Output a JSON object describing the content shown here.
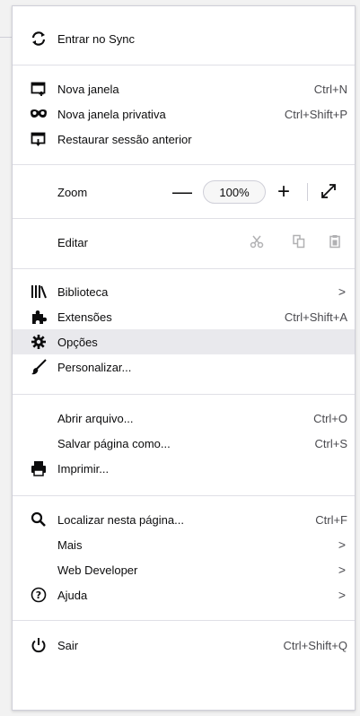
{
  "menu": {
    "sync": {
      "label": "Entrar no Sync",
      "icon": "sync-icon"
    },
    "new_window": {
      "label": "Nova janela",
      "shortcut": "Ctrl+N",
      "icon": "new-window-icon"
    },
    "private_window": {
      "label": "Nova janela privativa",
      "shortcut": "Ctrl+Shift+P",
      "icon": "private-mask-icon"
    },
    "restore_session": {
      "label": "Restaurar sessão anterior",
      "icon": "restore-session-icon"
    },
    "zoom": {
      "label": "Zoom",
      "minus": "—",
      "value": "100%",
      "plus": "+"
    },
    "edit": {
      "label": "Editar"
    },
    "library": {
      "label": "Biblioteca",
      "arrow": ">"
    },
    "extensions": {
      "label": "Extensões",
      "shortcut": "Ctrl+Shift+A"
    },
    "options": {
      "label": "Opções"
    },
    "customize": {
      "label": "Personalizar..."
    },
    "open_file": {
      "label": "Abrir arquivo...",
      "shortcut": "Ctrl+O"
    },
    "save_page": {
      "label": "Salvar página como...",
      "shortcut": "Ctrl+S"
    },
    "print": {
      "label": "Imprimir..."
    },
    "find": {
      "label": "Localizar nesta página...",
      "shortcut": "Ctrl+F"
    },
    "more": {
      "label": "Mais",
      "arrow": ">"
    },
    "web_developer": {
      "label": "Web Developer",
      "arrow": ">"
    },
    "help": {
      "label": "Ajuda",
      "arrow": ">"
    },
    "quit": {
      "label": "Sair",
      "shortcut": "Ctrl+Shift+Q"
    }
  },
  "colors": {
    "highlight": "#e9e9ed",
    "text": "#0c0c0d",
    "shortcut": "#4a4a4f",
    "disabled": "#b1b1b3"
  }
}
